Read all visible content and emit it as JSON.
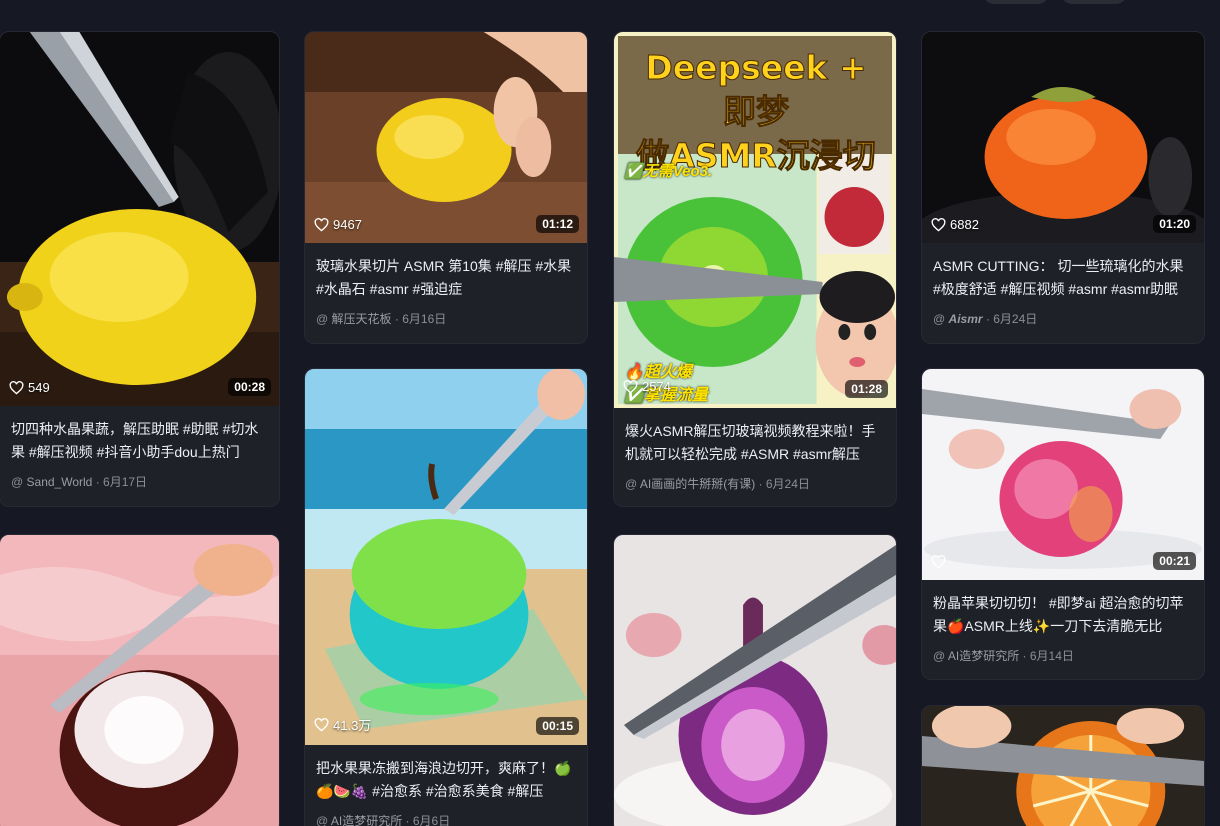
{
  "cards": [
    {
      "likes": "549",
      "duration": "00:28",
      "title": "切四种水晶果蔬，解压助眠 #助眠 #切水果 #解压视频 #抖音小助手dou上热门",
      "author": "Sand_World",
      "date": "· 6月17日"
    },
    {
      "likes": "9467",
      "duration": "01:12",
      "title": "玻璃水果切片 ASMR 第10集 #解压 #水果 #水晶石 #asmr #强迫症",
      "author": "解压天花板",
      "date": "· 6月16日"
    },
    {
      "likes": "2574",
      "duration": "01:28",
      "title": "爆火ASMR解压切玻璃视频教程来啦！手机就可以轻松完成 #ASMR #asmr解压",
      "author": "AI画画的牛掰掰(有课)",
      "date": "· 6月24日",
      "poster_line1": "Deepseek + 即梦",
      "poster_line2": "做ASMR沉浸切",
      "tag1": "无需Veo3.",
      "tag2": "超火爆",
      "tag3": "掌握流量"
    },
    {
      "likes": "6882",
      "duration": "01:20",
      "title": "ASMR CUTTING： 切一些琉璃化的水果 #极度舒适 #解压视频 #asmr #asmr助眠",
      "author": "Aismr",
      "date": "· 6月24日"
    },
    {
      "likes": "41.3万",
      "duration": "00:15",
      "title": "把水果果冻搬到海浪边切开，爽麻了！🍏🍊🍉🍇 #治愈系 #治愈系美食 #解压",
      "author": "AI造梦研究所",
      "date": "· 6月6日"
    },
    {
      "likes": "",
      "duration": "00:21",
      "title": "粉晶苹果切切切！ #即梦ai 超治愈的切苹果🍎ASMR上线✨一刀下去清脆无比",
      "author": "AI造梦研究所",
      "date": "· 6月14日"
    }
  ],
  "at_sign": "@",
  "colors": {
    "background": "#161823",
    "card": "#1f2129",
    "meta": "#8c8e98"
  }
}
